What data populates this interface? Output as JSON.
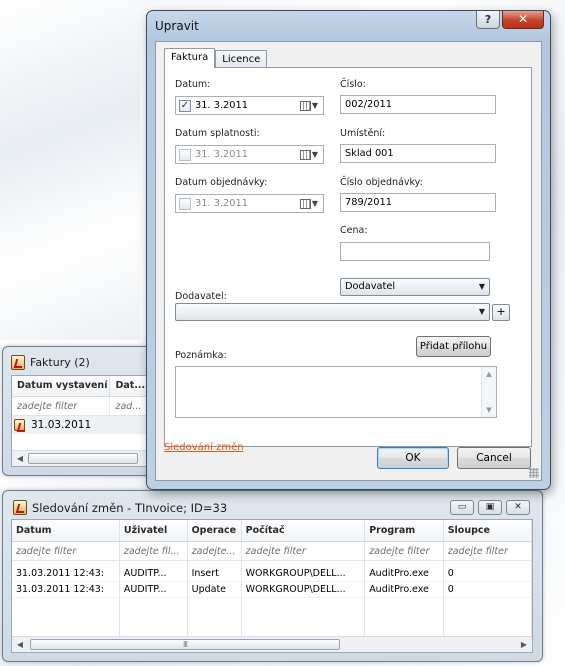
{
  "faktury": {
    "title": "Faktury (2)",
    "columns": [
      "Datum vystavení",
      "Dat..."
    ],
    "filter_placeholders": [
      "zadejte filter",
      "zad..."
    ],
    "rows": [
      {
        "date": "31.03.2011"
      }
    ]
  },
  "upravit": {
    "title": "Upravit",
    "help_label": "?",
    "close_label": "✕",
    "tabs": [
      "Faktura",
      "Licence"
    ],
    "fields": {
      "datum_label": "Datum:",
      "datum_value": "31.  3.2011",
      "datum_checked": "✓",
      "datum_splatnosti_label": "Datum splatnosti:",
      "datum_splatnosti_value": "31.  3.2011",
      "datum_objednavky_label": "Datum objednávky:",
      "datum_objednavky_value": "31.  3.2011",
      "cislo_label": "Číslo:",
      "cislo_value": "002/2011",
      "umisteni_label": "Umístění:",
      "umisteni_value": "Sklad 001",
      "cislo_objednavky_label": "Číslo objednávky:",
      "cislo_objednavky_value": "789/2011",
      "cena_label": "Cena:",
      "cena_value": "",
      "dodavatel_label": "Dodavatel:",
      "dodavatel_type": "Dodavatel",
      "dodavatel_value": "",
      "poznamka_label": "Poznámka:",
      "poznamka_value": ""
    },
    "pridat_prilohu": "Přidat přílohu",
    "plus_label": "+",
    "sledovani_link": "Sledování změn",
    "ok_label": "OK",
    "cancel_label": "Cancel"
  },
  "sledovani": {
    "title": "Sledování změn - TInvoice; ID=33",
    "controls": [
      "▭",
      "▣",
      "✕"
    ],
    "columns": [
      "Datum",
      "Uživatel",
      "Operace",
      "Počítač",
      "Program",
      "Sloupce"
    ],
    "filters": [
      "zadejte filter",
      "zadejte fil...",
      "zadejte...",
      "zadejte filter",
      "zadejte filter",
      "zadejte filter"
    ],
    "rows": [
      [
        "31.03.2011 12:43:",
        "AUDITP...",
        "Insert",
        "WORKGROUP\\DELL...",
        "AuditPro.exe",
        "0"
      ],
      [
        "31.03.2011 12:43:",
        "AUDITP...",
        "Update",
        "WORKGROUP\\DELL...",
        "AuditPro.exe",
        "0"
      ]
    ]
  },
  "scroll": {
    "thumb_grip": "III",
    "left": "◀",
    "right": "▶",
    "up": "▲",
    "down": "▼"
  },
  "colors": {
    "link": "#e05a1a",
    "title_bar": "#c5d7ea",
    "close_button": "#c4442b"
  }
}
